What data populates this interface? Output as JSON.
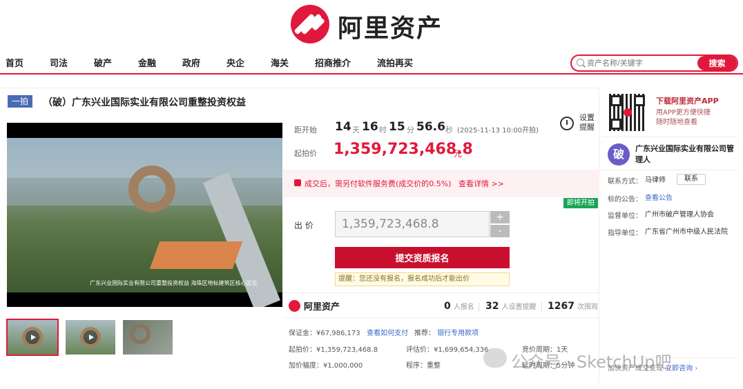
{
  "header": {
    "brand": "阿里资产",
    "brand_color": "#e1183c"
  },
  "nav": {
    "items": [
      "首页",
      "司法",
      "破产",
      "金融",
      "政府",
      "央企",
      "海关",
      "招商推介",
      "流拍再买"
    ]
  },
  "search": {
    "placeholder": "资产名称/关键字",
    "button": "搜索"
  },
  "lot": {
    "tag": "一拍",
    "title": "（破）广东兴业国际实业有限公司重整投资权益",
    "video_caption": "广东兴业国际实业有限公司重整投资权益 海珠区地标建筑区核心区位"
  },
  "countdown": {
    "label": "距开始",
    "days": "14",
    "days_unit": "天",
    "hours": "16",
    "hours_unit": "时",
    "minutes": "15",
    "minutes_unit": "分",
    "seconds": "56.6",
    "seconds_unit": "秒",
    "start": "(2025-11-13 10:00开拍)"
  },
  "remind": {
    "label": "设置提醒"
  },
  "start_price": {
    "label": "起拍价",
    "value": "1,359,723,468.8",
    "unit": "元"
  },
  "fee": {
    "text": "成交后，需另付软件服务费(成交价的0.5%)",
    "link": "查看详情 >>"
  },
  "status_badge": "即将开拍",
  "bid": {
    "label": "出 价",
    "value": "1,359,723,468.8",
    "plus": "+",
    "minus": "-",
    "submit": "提交资质报名",
    "tip": "提醒：您还没有报名，报名成功后才能出价"
  },
  "stats": {
    "brand": "阿里资产",
    "registrants": "0",
    "registrants_label": "人报名",
    "reminders": "32",
    "reminders_label": "人设置提醒",
    "views": "1267",
    "views_label": "次围观"
  },
  "details": {
    "deposit_label": "保证金：",
    "deposit": "¥67,986,173",
    "deposit_link": "查看如何支付",
    "recommend_label": "推荐：",
    "recommend_link": "银行专用款项",
    "start_label": "起拍价：",
    "start": "¥1,359,723,468.8",
    "appraisal_label": "评估价：",
    "appraisal": "¥1,699,654,336",
    "cycle_label": "竞价周期：",
    "cycle": "1天",
    "increment_label": "加价幅度：",
    "increment": "¥1,000,000",
    "procedure_label": "程序：",
    "procedure": "重整",
    "extend_label": "延时周期：",
    "extend": "5分钟"
  },
  "sidebar": {
    "app_title": "下载阿里资产APP",
    "app_sub1": "用APP更方便快捷",
    "app_sub2": "随时随地查看",
    "org_avatar": "破",
    "org_name": "广东兴业国际实业有限公司管理人",
    "contact_label": "联系方式：",
    "contact_value": "马律师",
    "contact_button": "联系",
    "notice_label": "标的公告：",
    "notice_link": "查看公告",
    "supervisor_label": "监督单位：",
    "supervisor": "广州市破产管理人协会",
    "guide_label": "指导单位：",
    "guide": "广东省广州市中级人民法院",
    "promo_text": "加快资产成交变现",
    "promo_link": "立即咨询"
  },
  "watermark": "公众号 · SketchUp吧"
}
